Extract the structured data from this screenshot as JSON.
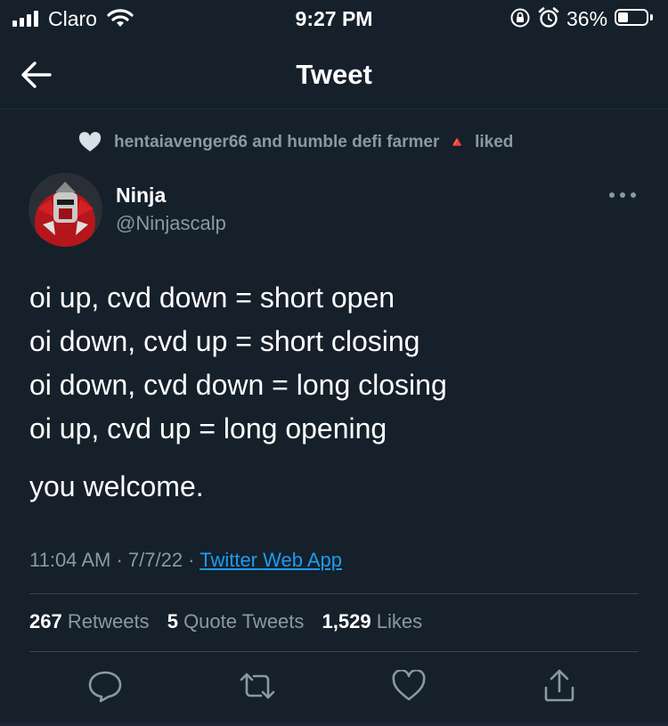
{
  "status_bar": {
    "carrier": "Claro",
    "time": "9:27 PM",
    "battery_percent": "36%",
    "battery_level": 0.36,
    "icons": [
      "signal-icon",
      "wifi-icon",
      "orientation-lock-icon",
      "alarm-icon",
      "battery-icon"
    ]
  },
  "header": {
    "title": "Tweet",
    "back_icon": "arrow-left-icon"
  },
  "social_context": {
    "text_before": "hentaiavenger66 and humble defi farmer",
    "emoji": "🔺",
    "text_after": "liked",
    "icon": "heart-icon"
  },
  "author": {
    "name": "Ninja",
    "handle": "@Ninjascalp"
  },
  "tweet": {
    "lines": [
      "oi up, cvd down = short open",
      "oi down, cvd up = short closing",
      "oi down, cvd down = long closing",
      "oi up, cvd up = long opening"
    ],
    "closing": "you welcome."
  },
  "meta": {
    "time": "11:04 AM",
    "sep1": " · ",
    "date": "7/7/22",
    "sep2": " · ",
    "source": "Twitter Web App"
  },
  "stats": {
    "retweets_count": "267",
    "retweets_label": "Retweets",
    "quotes_count": "5",
    "quotes_label": "Quote Tweets",
    "likes_count": "1,529",
    "likes_label": "Likes"
  },
  "actions": [
    "reply-icon",
    "retweet-icon",
    "like-icon",
    "share-icon"
  ],
  "colors": {
    "background": "#15202b",
    "secondary_text": "#8b98a5",
    "link": "#1d9bf0",
    "divider": "#38444d"
  }
}
